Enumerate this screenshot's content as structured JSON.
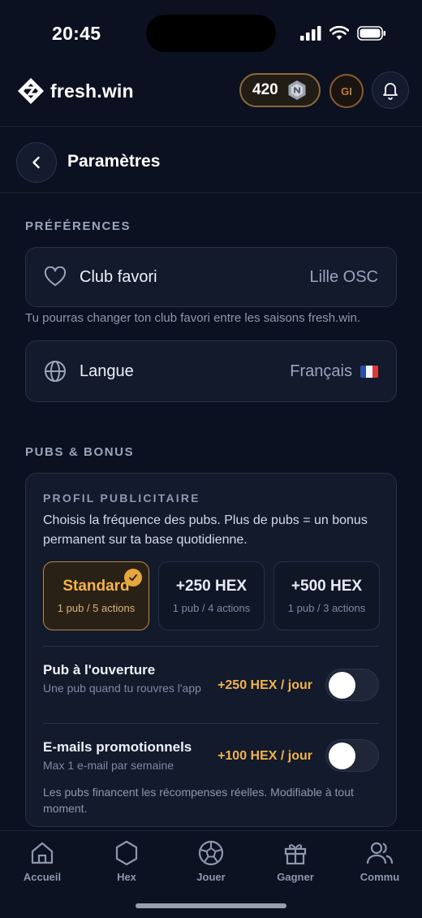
{
  "status_bar": {
    "time": "20:45"
  },
  "header": {
    "brand": "fresh.win",
    "balance": "420",
    "avatar_initials": "GI"
  },
  "page": {
    "title": "Paramètres"
  },
  "preferences": {
    "section_label": "PRÉFÉRENCES",
    "club": {
      "label": "Club favori",
      "value": "Lille OSC",
      "icon": "heart-icon"
    },
    "club_hint": "Tu pourras changer ton club favori entre les saisons fresh.win.",
    "language": {
      "label": "Langue",
      "value": "Français",
      "icon": "globe-icon",
      "flag": "🇫🇷"
    }
  },
  "ads": {
    "section_label": "PUBS & BONUS",
    "profile_title": "PROFIL PUBLICITAIRE",
    "profile_desc": "Choisis la fréquence des pubs. Plus de pubs = un bonus permanent sur ta base quotidienne.",
    "options": [
      {
        "name": "Standard",
        "sub": "1 pub / 5 actions",
        "selected": true
      },
      {
        "name": "+250 HEX",
        "sub": "1 pub / 4 actions",
        "selected": false
      },
      {
        "name": "+500 HEX",
        "sub": "1 pub / 3 actions",
        "selected": false
      }
    ],
    "opening_ad": {
      "title": "Pub à l'ouverture",
      "subtitle": "Une pub quand tu rouvres l'app",
      "bonus": "+250 HEX / jour",
      "enabled": false
    },
    "promo_emails": {
      "title": "E-mails promotionnels",
      "subtitle": "Max 1 e-mail par semaine",
      "bonus": "+100 HEX / jour",
      "enabled": false
    },
    "footnote": "Les pubs financent les récompenses réelles. Modifiable à tout moment."
  },
  "bottom_nav": [
    {
      "label": "Accueil",
      "icon": "home-icon"
    },
    {
      "label": "Hex",
      "icon": "hexagon-icon"
    },
    {
      "label": "Jouer",
      "icon": "soccer-ball-icon"
    },
    {
      "label": "Gagner",
      "icon": "gift-icon"
    },
    {
      "label": "Commu",
      "icon": "users-icon"
    }
  ],
  "colors": {
    "background": "#0b1120",
    "accent": "#f3b34c",
    "card": "#121a2c"
  }
}
